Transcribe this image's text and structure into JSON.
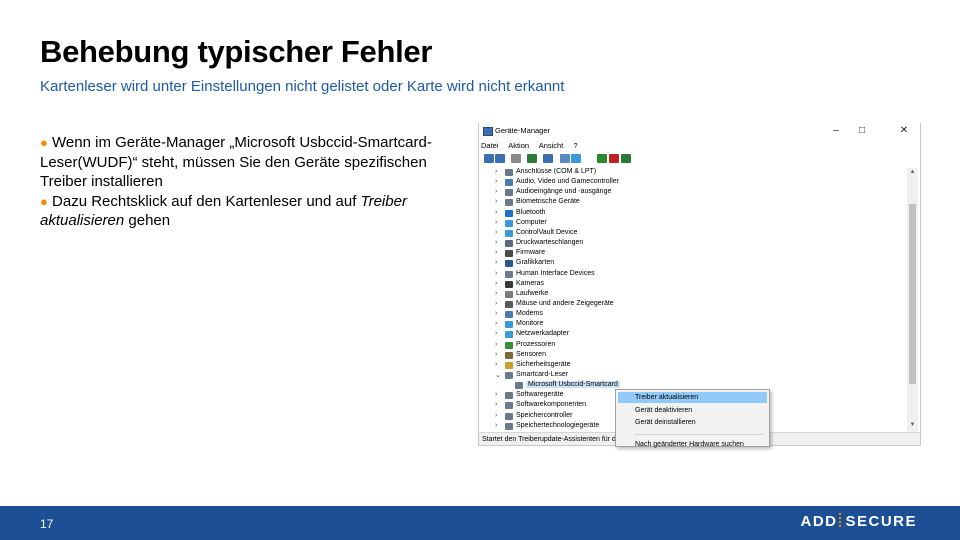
{
  "slide": {
    "title": "Behebung typischer Fehler",
    "subtitle": "Kartenleser wird unter Einstellungen nicht gelistet oder Karte wird nicht erkannt",
    "bullets": [
      {
        "text": "Wenn im Geräte-Manager „Microsoft Usbccid-Smartcard-Leser(WUDF)“ steht, müssen Sie den Geräte spezifischen Treiber installieren"
      },
      {
        "before": "Dazu Rechtsklick auf den Kartenleser und auf ",
        "italic": "Treiber aktualisieren",
        "after": " gehen"
      }
    ],
    "page_number": "17",
    "logo": {
      "left": "ADD",
      "right": "SECURE"
    },
    "colors": {
      "accent": "#f28c00",
      "brand_blue": "#1c4f93",
      "subtitle_blue": "#1f5aa6"
    }
  },
  "window": {
    "title": "Geräte-Manager",
    "controls": {
      "minimize": "–",
      "maximize": "□",
      "close": "✕"
    },
    "menu": [
      "Datei",
      "Aktion",
      "Ansicht",
      "?"
    ],
    "toolbar_icons": [
      "back-icon",
      "forward-icon",
      "properties-icon",
      "update-driver-icon",
      "help-icon",
      "scan-icon",
      "monitor-icon",
      "enable-icon",
      "uninstall-icon",
      "add-icon"
    ],
    "tree": [
      {
        "label": "Anschlüsse (COM & LPT)",
        "expanded": false,
        "color": "#6a7a8a"
      },
      {
        "label": "Audio, Video und Gamecontroller",
        "expanded": false,
        "color": "#4a7ab0"
      },
      {
        "label": "Audioeingänge und -ausgänge",
        "expanded": false,
        "color": "#6a7a8a"
      },
      {
        "label": "Biometrische Geräte",
        "expanded": false,
        "color": "#6a7a8a"
      },
      {
        "label": "Bluetooth",
        "expanded": false,
        "color": "#1e6fd0"
      },
      {
        "label": "Computer",
        "expanded": false,
        "color": "#3a9ad9"
      },
      {
        "label": "ControlVault Device",
        "expanded": false,
        "color": "#3a9ad9"
      },
      {
        "label": "Druckwarteschlangen",
        "expanded": false,
        "color": "#5a6a7a"
      },
      {
        "label": "Firmware",
        "expanded": false,
        "color": "#4a4a4a"
      },
      {
        "label": "Grafikkarten",
        "expanded": false,
        "color": "#2a5a8a"
      },
      {
        "label": "Human Interface Devices",
        "expanded": false,
        "color": "#6a7a8a"
      },
      {
        "label": "Kameras",
        "expanded": false,
        "color": "#3a3a3a"
      },
      {
        "label": "Laufwerke",
        "expanded": false,
        "color": "#7a7a7a"
      },
      {
        "label": "Mäuse und andere Zeigegeräte",
        "expanded": false,
        "color": "#5a5a5a"
      },
      {
        "label": "Modems",
        "expanded": false,
        "color": "#4a7ab0"
      },
      {
        "label": "Monitore",
        "expanded": false,
        "color": "#3a9ad9"
      },
      {
        "label": "Netzwerkadapter",
        "expanded": false,
        "color": "#3a9ad9"
      },
      {
        "label": "Prozessoren",
        "expanded": false,
        "color": "#3a8a3a"
      },
      {
        "label": "Sensoren",
        "expanded": false,
        "color": "#7a6a3a"
      },
      {
        "label": "Sicherheitsgeräte",
        "expanded": false,
        "color": "#c8a030"
      },
      {
        "label": "Smartcard-Leser",
        "expanded": true,
        "color": "#6a7a8a"
      },
      {
        "label": "Microsoft Usbccid-Smartcard",
        "child": true,
        "color": "#6a7a8a"
      },
      {
        "label": "Softwaregeräte",
        "expanded": false,
        "color": "#6a7a8a"
      },
      {
        "label": "Softwarekomponenten",
        "expanded": false,
        "color": "#6a7a8a"
      },
      {
        "label": "Speichercontroller",
        "expanded": false,
        "color": "#6a7a8a"
      },
      {
        "label": "Speichertechnologiegeräte",
        "expanded": false,
        "color": "#6a7a8a"
      }
    ],
    "status": "Startet den Treiberupdate-Assistenten für das"
  },
  "context_menu": [
    {
      "label": "Treiber aktualisieren",
      "highlighted": true
    },
    {
      "label": "Gerät deaktivieren",
      "highlighted": false
    },
    {
      "label": "Gerät deinstallieren",
      "highlighted": false
    },
    {
      "separator": true
    },
    {
      "label": "Nach geänderter Hardware suchen",
      "highlighted": false
    }
  ]
}
